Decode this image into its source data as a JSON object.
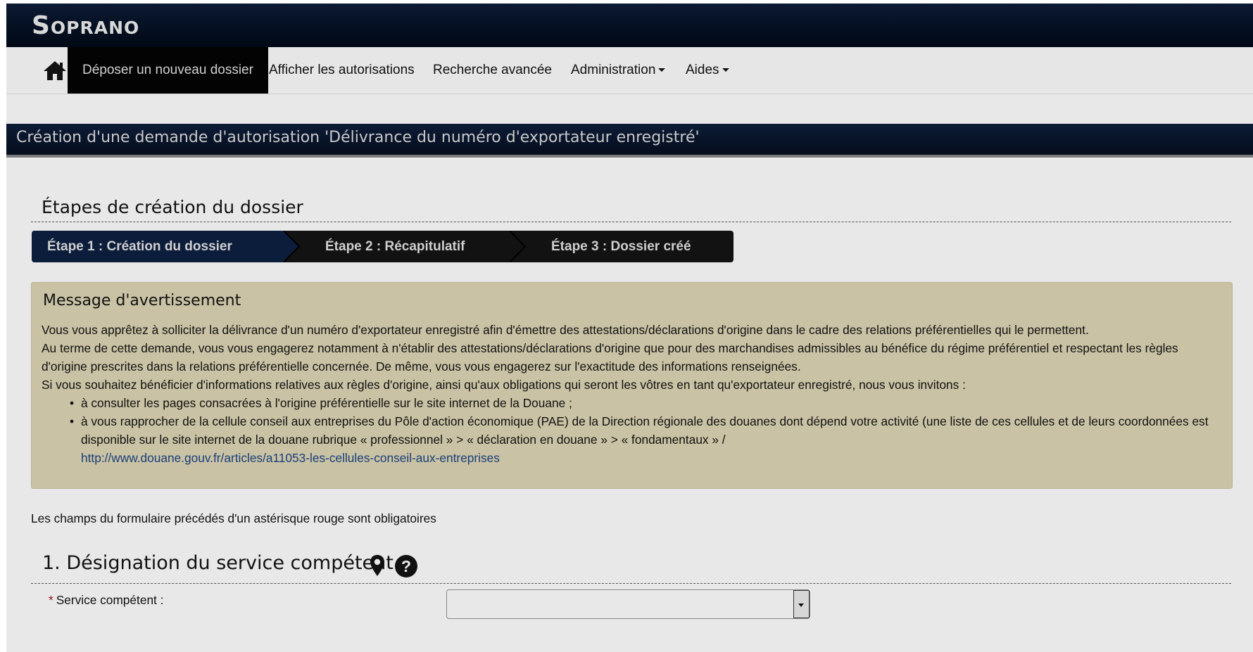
{
  "app": {
    "brand": "Soprano"
  },
  "nav": {
    "home_icon": "home-icon",
    "items": [
      {
        "label": "Déposer un nouveau dossier",
        "active": true
      },
      {
        "label": "Afficher les autorisations"
      },
      {
        "label": "Recherche avancée"
      },
      {
        "label": "Administration",
        "dropdown": true
      },
      {
        "label": "Aides",
        "dropdown": true
      }
    ]
  },
  "page": {
    "title": "Création d'une demande d'autorisation 'Délivrance du numéro d'exportateur enregistré'"
  },
  "steps": {
    "heading": "Étapes de création du dossier",
    "items": [
      {
        "label": "Étape 1 : Création du dossier",
        "active": true
      },
      {
        "label": "Étape 2 : Récapitulatif"
      },
      {
        "label": "Étape 3 : Dossier créé"
      }
    ]
  },
  "warning": {
    "title": "Message d'avertissement",
    "p1": "Vous vous apprêtez à solliciter la délivrance d'un numéro d'exportateur enregistré afin d'émettre des attestations/déclarations d'origine dans le cadre des relations préférentielles qui le permettent.",
    "p2": "Au terme de cette demande, vous vous engagerez notamment à n'établir des attestations/déclarations d'origine que pour des marchandises admissibles au bénéfice du régime préférentiel et respectant les règles d'origine prescrites dans la relations préférentielle concernée. De même, vous vous engagerez sur l'exactitude des informations renseignées.",
    "p3": "Si vous souhaitez bénéficier d'informations relatives aux règles d'origine, ainsi qu'aux obligations qui seront les vôtres en tant qu'exportateur enregistré, nous vous invitons :",
    "bullet1": "à consulter les pages consacrées à l'origine préférentielle sur le site internet de la Douane ;",
    "bullet2": "à vous rapprocher de la cellule conseil aux entreprises du Pôle d'action économique (PAE) de la Direction régionale des douanes dont dépend votre activité (une liste de ces cellules et de leurs coordonnées est disponible sur le site internet de la douane rubrique « professionnel » > « déclaration en douane » > « fondamentaux » /",
    "link": "http://www.douane.gouv.fr/articles/a11053-les-cellules-conseil-aux-entreprises"
  },
  "form": {
    "mandatory_note": "Les champs du formulaire précédés d'un astérisque rouge sont obligatoires",
    "section1": {
      "title": "1. Désignation du service compétent",
      "icons": [
        "map-marker-icon",
        "help-icon"
      ],
      "field_label": "Service compétent :",
      "required_mark": "*",
      "select_value": ""
    }
  },
  "colors": {
    "header_bg": "#0b1a33",
    "active_nav": "#030303",
    "warning_bg": "#c9c2a4",
    "link": "#1a3e7a",
    "required": "#aa1111"
  }
}
